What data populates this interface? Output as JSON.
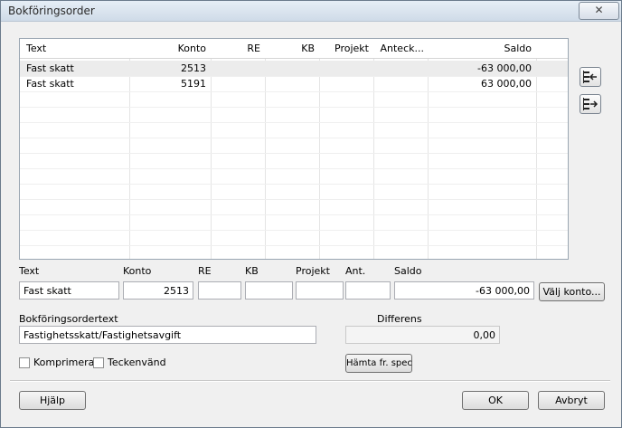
{
  "window": {
    "title": "Bokföringsorder",
    "close_label": "✕"
  },
  "grid": {
    "columns": [
      "Text",
      "Konto",
      "RE",
      "KB",
      "Projekt",
      "Anteck...",
      "Saldo"
    ],
    "rows": [
      {
        "text": "Fast skatt",
        "konto": "2513",
        "saldo": "-63 000,00"
      },
      {
        "text": "Fast skatt",
        "konto": "5191",
        "saldo": "63 000,00"
      }
    ]
  },
  "side_buttons": {
    "insert_icon": "insert-row-icon",
    "append_icon": "append-row-icon"
  },
  "editor": {
    "labels": {
      "text": "Text",
      "konto": "Konto",
      "re": "RE",
      "kb": "KB",
      "projekt": "Projekt",
      "ant": "Ant.",
      "saldo": "Saldo"
    },
    "values": {
      "text": "Fast skatt",
      "konto": "2513",
      "re": "",
      "kb": "",
      "projekt": "",
      "ant": "",
      "saldo": "-63 000,00"
    },
    "valj_konto_label": "Välj konto..."
  },
  "order_text": {
    "label": "Bokföringsordertext",
    "value": "Fastighetsskatt/Fastighetsavgift"
  },
  "differens": {
    "label": "Differens",
    "value": "0,00"
  },
  "options": {
    "komprimera_label": "Komprimera",
    "teckenvand_label": "Teckenvänd"
  },
  "hamta_label": "Hämta fr. spec",
  "footer": {
    "help_label": "Hjälp",
    "ok_label": "OK",
    "cancel_label": "Avbryt"
  }
}
